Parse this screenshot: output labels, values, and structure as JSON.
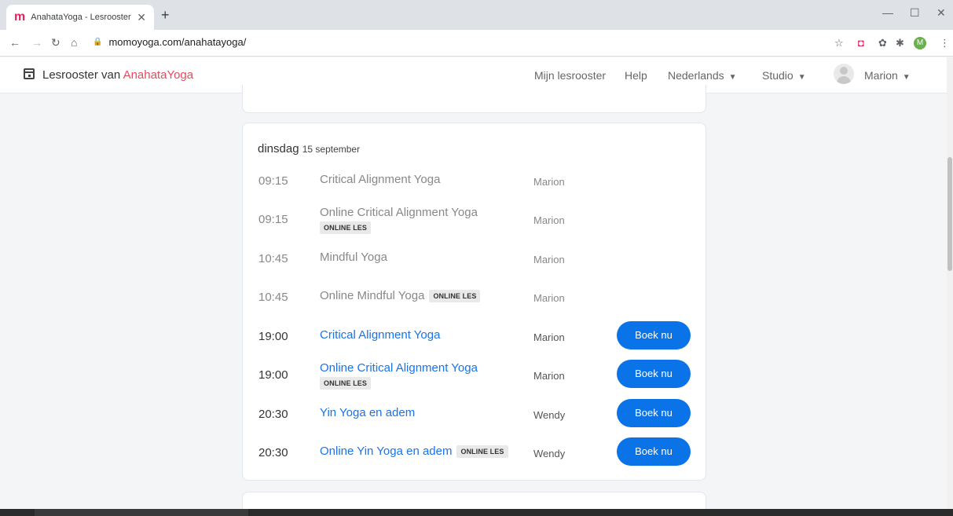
{
  "browser": {
    "tab_title": "AnahataYoga - Lesrooster",
    "tab_favicon": "m",
    "url": "momoyoga.com/anahatayoga/",
    "profile_initial": "M"
  },
  "header": {
    "prefix": "Lesrooster van ",
    "studio": "AnahataYoga",
    "nav": {
      "my_schedule": "Mijn lesrooster",
      "help": "Help",
      "language": "Nederlands",
      "studio_menu": "Studio",
      "user": "Marion"
    }
  },
  "day": {
    "weekday": "dinsdag",
    "date": "15 september"
  },
  "badge_label": "ONLINE LES",
  "book_label": "Boek nu",
  "classes": [
    {
      "time": "09:15",
      "name": "Critical Alignment Yoga",
      "teacher": "Marion"
    },
    {
      "time": "09:15",
      "name": "Online Critical Alignment Yoga",
      "teacher": "Marion"
    },
    {
      "time": "10:45",
      "name": "Mindful Yoga",
      "teacher": "Marion"
    },
    {
      "time": "10:45",
      "name": "Online Mindful Yoga",
      "teacher": "Marion"
    },
    {
      "time": "19:00",
      "name": "Critical Alignment Yoga",
      "teacher": "Marion"
    },
    {
      "time": "19:00",
      "name": "Online Critical Alignment Yoga",
      "teacher": "Marion"
    },
    {
      "time": "20:30",
      "name": "Yin Yoga en adem",
      "teacher": "Wendy"
    },
    {
      "time": "20:30",
      "name": "Online Yin Yoga en adem",
      "teacher": "Wendy"
    }
  ],
  "colors": {
    "accent": "#1a73e8",
    "button": "#0a73e8",
    "brand": "#e84a5f"
  }
}
